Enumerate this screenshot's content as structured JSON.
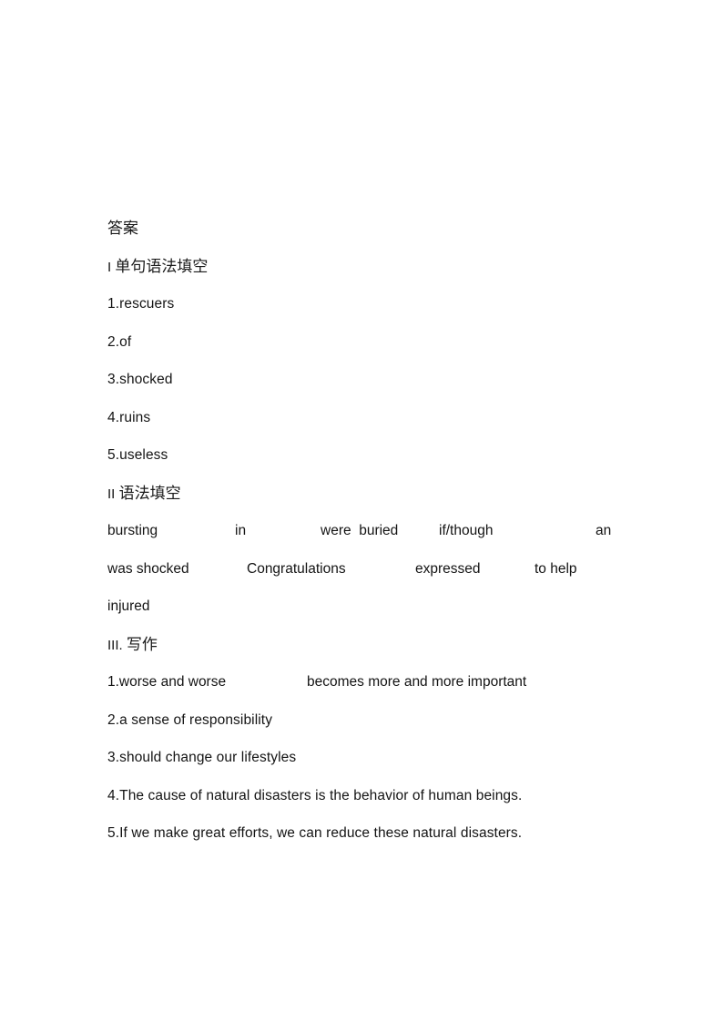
{
  "document": {
    "title": "答案",
    "sections": [
      {
        "numeral": "I",
        "heading": "单句语法填空",
        "items": [
          "1.rescuers",
          "2.of",
          "3.shocked",
          "4.ruins",
          "5.useless"
        ]
      },
      {
        "numeral": "II",
        "heading": "语法填空",
        "bank_rows": [
          [
            "bursting",
            "in",
            "were  buried",
            "if/though",
            "an"
          ],
          [
            "was shocked",
            "Congratulations",
            "expressed",
            "to help"
          ],
          [
            "injured"
          ]
        ]
      },
      {
        "numeral": "III.",
        "heading": "写作",
        "writing_items": [
          {
            "left": "1.worse and worse",
            "right": "becomes more and more important"
          },
          {
            "left": "2.a sense of responsibility",
            "right": ""
          },
          {
            "left": "3.should change our lifestyles",
            "right": ""
          },
          {
            "left": "4.The cause of natural disasters is the behavior of human beings.",
            "right": ""
          },
          {
            "left": "5.If we make great efforts, we can reduce these natural disasters.",
            "right": ""
          }
        ]
      }
    ]
  },
  "colors": {
    "page_background": "#ffffff",
    "body_text": "#141414",
    "heading_text": "#1a1a1a"
  }
}
